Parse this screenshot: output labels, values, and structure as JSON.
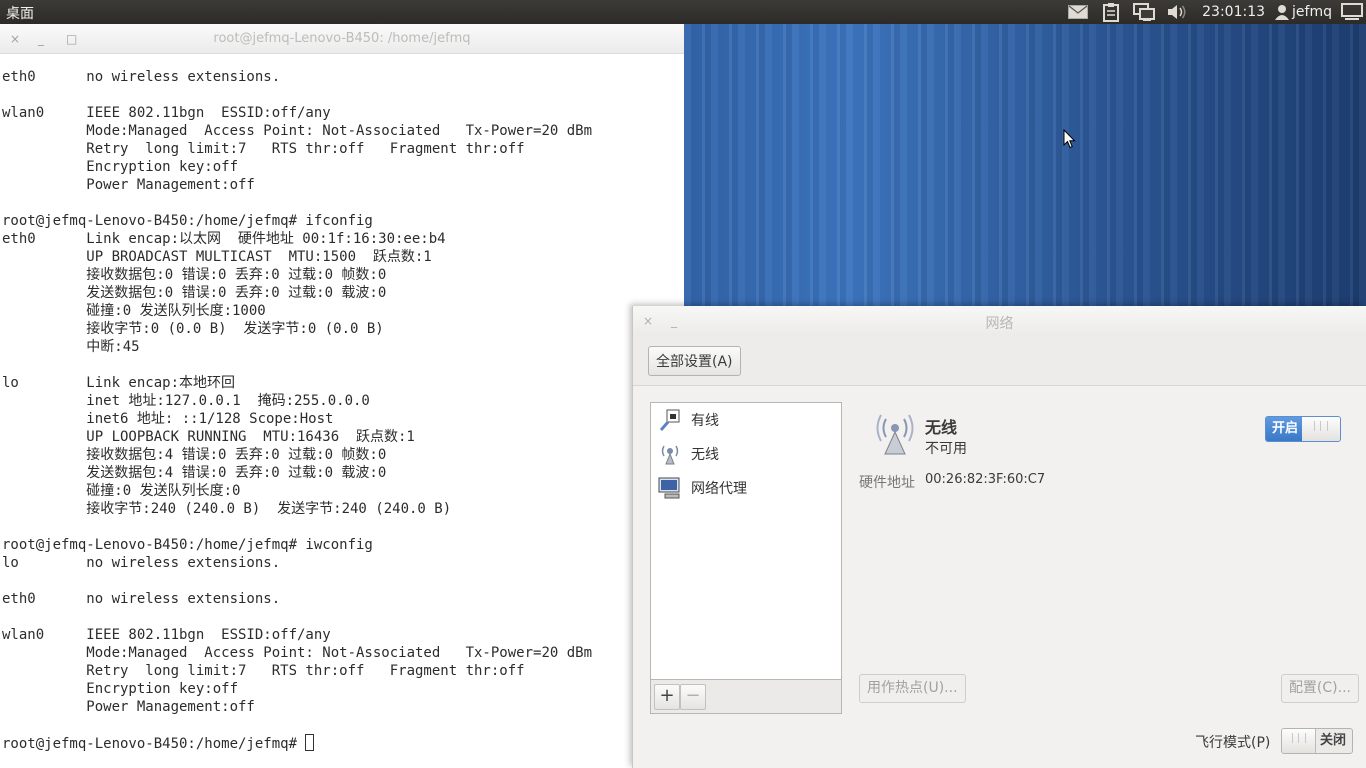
{
  "top_panel": {
    "desktop_label": "桌面",
    "clock": "23:01:13",
    "user": "jefmq",
    "tray_icons": [
      "mail-icon",
      "clipboard-icon",
      "network-icon",
      "volume-icon"
    ]
  },
  "terminal": {
    "title": "root@jefmq-Lenovo-B450: /home/jefmq",
    "buttons": {
      "close": "×",
      "minimize": "_",
      "maximize": "□"
    },
    "lines": [
      "eth0      no wireless extensions.",
      "",
      "wlan0     IEEE 802.11bgn  ESSID:off/any",
      "          Mode:Managed  Access Point: Not-Associated   Tx-Power=20 dBm",
      "          Retry  long limit:7   RTS thr:off   Fragment thr:off",
      "          Encryption key:off",
      "          Power Management:off",
      "",
      "root@jefmq-Lenovo-B450:/home/jefmq# ifconfig",
      "eth0      Link encap:以太网  硬件地址 00:1f:16:30:ee:b4",
      "          UP BROADCAST MULTICAST  MTU:1500  跃点数:1",
      "          接收数据包:0 错误:0 丢弃:0 过载:0 帧数:0",
      "          发送数据包:0 错误:0 丢弃:0 过载:0 载波:0",
      "          碰撞:0 发送队列长度:1000",
      "          接收字节:0 (0.0 B)  发送字节:0 (0.0 B)",
      "          中断:45",
      "",
      "lo        Link encap:本地环回",
      "          inet 地址:127.0.0.1  掩码:255.0.0.0",
      "          inet6 地址: ::1/128 Scope:Host",
      "          UP LOOPBACK RUNNING  MTU:16436  跃点数:1",
      "          接收数据包:4 错误:0 丢弃:0 过载:0 帧数:0",
      "          发送数据包:4 错误:0 丢弃:0 过载:0 载波:0",
      "          碰撞:0 发送队列长度:0",
      "          接收字节:240 (240.0 B)  发送字节:240 (240.0 B)",
      "",
      "root@jefmq-Lenovo-B450:/home/jefmq# iwconfig",
      "lo        no wireless extensions.",
      "",
      "eth0      no wireless extensions.",
      "",
      "wlan0     IEEE 802.11bgn  ESSID:off/any",
      "          Mode:Managed  Access Point: Not-Associated   Tx-Power=20 dBm",
      "          Retry  long limit:7   RTS thr:off   Fragment thr:off",
      "          Encryption key:off",
      "          Power Management:off",
      ""
    ],
    "prompt": "root@jefmq-Lenovo-B450:/home/jefmq# "
  },
  "network": {
    "title": "网络",
    "buttons": {
      "close": "×",
      "minimize": "_"
    },
    "all_settings": "全部设置(A)",
    "connections": [
      {
        "label": "有线",
        "icon": "wired-network-icon"
      },
      {
        "label": "无线",
        "icon": "wireless-network-icon"
      },
      {
        "label": "网络代理",
        "icon": "network-proxy-icon"
      }
    ],
    "add": "+",
    "remove": "−",
    "device": {
      "name": "无线",
      "status": "不可用",
      "hw_label": "硬件地址",
      "hw_value": "00:26:82:3F:60:C7",
      "toggle_on": "开启"
    },
    "hotspot": "用作热点(U)...",
    "configure": "配置(C)...",
    "airplane_label": "飞行模式(P)",
    "airplane_off": "关闭"
  },
  "colors": {
    "accent": "#3b78c7",
    "panel": "#3c3b37",
    "wallpaper": "#3467ae"
  }
}
